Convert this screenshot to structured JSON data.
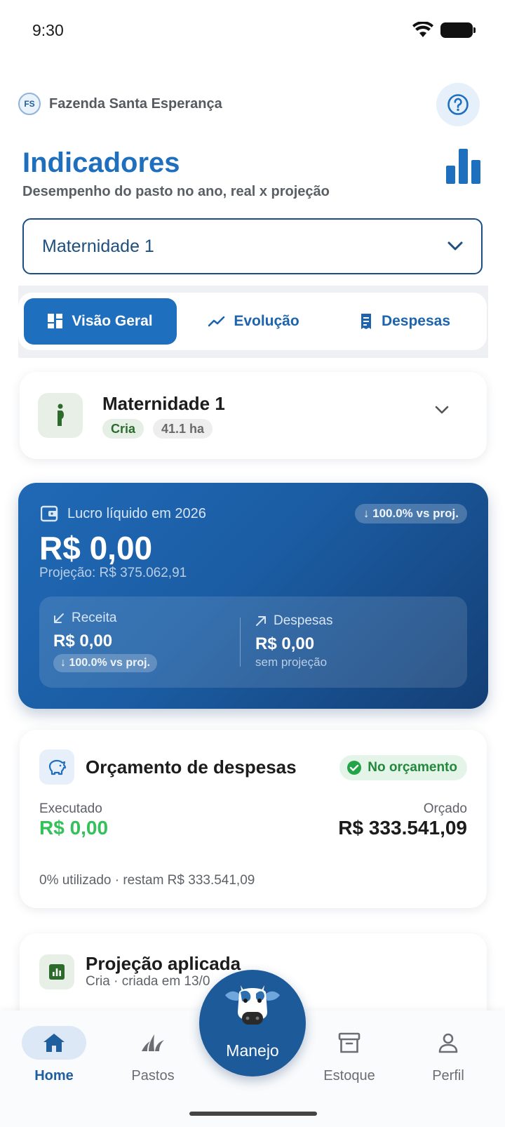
{
  "status_bar": {
    "time": "9:30"
  },
  "header": {
    "farm_initials": "FS",
    "farm_name": "Fazenda Santa Esperança",
    "title": "Indicadores",
    "subtitle": "Desempenho do pasto no ano, real x projeção"
  },
  "pasture_select": {
    "value": "Maternidade 1"
  },
  "tabs": [
    {
      "label": "Visão Geral",
      "icon": "dashboard-icon",
      "active": true
    },
    {
      "label": "Evolução",
      "icon": "trend-line-icon",
      "active": false
    },
    {
      "label": "Despesas",
      "icon": "receipt-icon",
      "active": false
    }
  ],
  "pasture_card": {
    "name": "Maternidade 1",
    "category": "Cria",
    "area": "41.1 ha"
  },
  "profit_card": {
    "label": "Lucro líquido em 2026",
    "badge": "↓ 100.0% vs proj.",
    "value": "R$ 0,00",
    "projection": "Projeção: R$ 375.062,91",
    "revenue": {
      "label": "Receita",
      "value": "R$ 0,00",
      "badge": "↓ 100.0% vs proj."
    },
    "expenses": {
      "label": "Despesas",
      "value": "R$ 0,00",
      "note": "sem projeção"
    }
  },
  "budget_card": {
    "title": "Orçamento de despesas",
    "status": "No orçamento",
    "executed_label": "Executado",
    "executed_value": "R$ 0,00",
    "budgeted_label": "Orçado",
    "budgeted_value": "R$ 333.541,09",
    "footer": "0% utilizado · restam R$ 333.541,09"
  },
  "projection_card": {
    "title": "Projeção aplicada",
    "subtitle": "Cria · criada em 13/0"
  },
  "bottom_nav": {
    "items": [
      {
        "label": "Home",
        "icon": "home-icon",
        "active": true
      },
      {
        "label": "Pastos",
        "icon": "grass-icon",
        "active": false
      },
      {
        "label": "Estoque",
        "icon": "archive-box-icon",
        "active": false
      },
      {
        "label": "Perfil",
        "icon": "person-icon",
        "active": false
      }
    ],
    "center_button": {
      "label": "Manejo",
      "icon": "cow-icon"
    }
  },
  "colors": {
    "primary": "#1f6fbf",
    "dark_blue": "#1c5a99",
    "success": "#34c15a",
    "status_green": "#22883c"
  }
}
